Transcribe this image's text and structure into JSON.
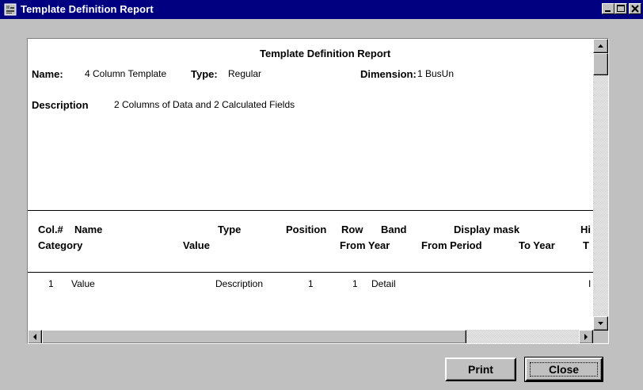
{
  "window": {
    "title": "Template Definition Report"
  },
  "report": {
    "heading": "Template Definition Report",
    "name_label": "Name:",
    "name_value": "4 Column Template",
    "type_label": "Type:",
    "type_value": "Regular",
    "dimension_label": "Dimension:",
    "dimension_value": "1 BusUn",
    "description_label": "Description",
    "description_value": "2 Columns of Data and 2 Calculated Fields",
    "columns_row1": [
      "Col.#",
      "Name",
      "Type",
      "Position",
      "Row",
      "Band",
      "Display mask",
      "Hi"
    ],
    "columns_row2": [
      "Category",
      "Value",
      "From Year",
      "From Period",
      "To Year",
      "T"
    ],
    "row": {
      "col": "1",
      "name": "Value",
      "type": "Description",
      "position": "1",
      "row": "1",
      "band": "Detail",
      "trail": "I"
    }
  },
  "buttons": {
    "print": "Print",
    "close": "Close"
  }
}
